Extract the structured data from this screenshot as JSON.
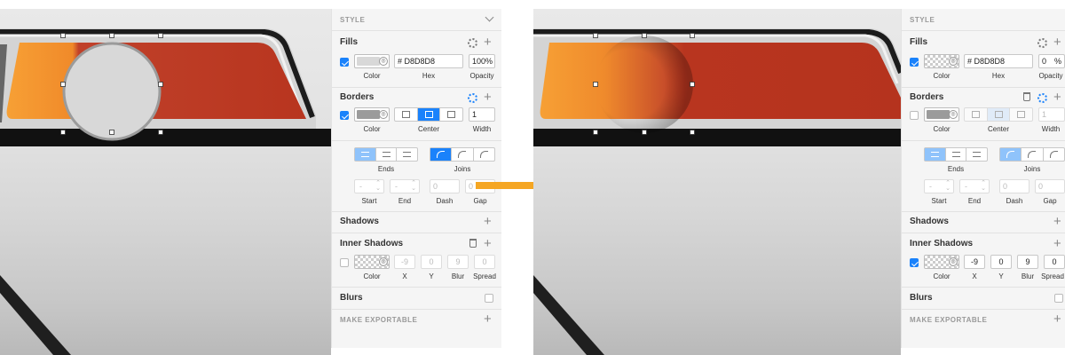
{
  "colors": {
    "accent": "#1a82fb",
    "arrow": "#f5a623",
    "fill_gray": "#D8D8D8",
    "border_gray": "#9b9b9b",
    "panel_bg": "#f5f5f5"
  },
  "arrow_icon": "right-arrow-icon",
  "before": {
    "style_header": "STYLE",
    "fills": {
      "title": "Fills",
      "hex": "# D8D8D8",
      "opacity": "100%",
      "captions": {
        "color": "Color",
        "hex": "Hex",
        "opacity": "Opacity"
      }
    },
    "borders": {
      "title": "Borders",
      "width": "1",
      "captions": {
        "color": "Color",
        "position": "Center",
        "width": "Width"
      }
    },
    "ends_joins": {
      "ends": "Ends",
      "joins": "Joins"
    },
    "dash": {
      "start": "-",
      "end": "-",
      "dash": "0",
      "gap": "0",
      "captions": {
        "start": "Start",
        "end": "End",
        "dash": "Dash",
        "gap": "Gap"
      }
    },
    "shadows": {
      "title": "Shadows"
    },
    "inner_shadows": {
      "title": "Inner Shadows",
      "x": "-9",
      "y": "0",
      "blur": "9",
      "spread": "0",
      "captions": {
        "color": "Color",
        "x": "X",
        "y": "Y",
        "blur": "Blur",
        "spread": "Spread"
      }
    },
    "blurs": {
      "title": "Blurs"
    },
    "export": {
      "title": "MAKE EXPORTABLE"
    }
  },
  "after": {
    "style_header": "STYLE",
    "fills": {
      "title": "Fills",
      "hex": "# D8D8D8",
      "opacity": "0",
      "opacity_unit": "%",
      "captions": {
        "color": "Color",
        "hex": "Hex",
        "opacity": "Opacity"
      }
    },
    "borders": {
      "title": "Borders",
      "width": "1",
      "captions": {
        "color": "Color",
        "position": "Center",
        "width": "Width"
      }
    },
    "ends_joins": {
      "ends": "Ends",
      "joins": "Joins"
    },
    "dash": {
      "start": "-",
      "end": "-",
      "dash": "0",
      "gap": "0",
      "captions": {
        "start": "Start",
        "end": "End",
        "dash": "Dash",
        "gap": "Gap"
      }
    },
    "shadows": {
      "title": "Shadows"
    },
    "inner_shadows": {
      "title": "Inner Shadows",
      "x": "-9",
      "y": "0",
      "blur": "9",
      "spread": "0",
      "captions": {
        "color": "Color",
        "x": "X",
        "y": "Y",
        "blur": "Blur",
        "spread": "Spread"
      }
    },
    "blurs": {
      "title": "Blurs"
    },
    "export": {
      "title": "MAKE EXPORTABLE"
    }
  }
}
